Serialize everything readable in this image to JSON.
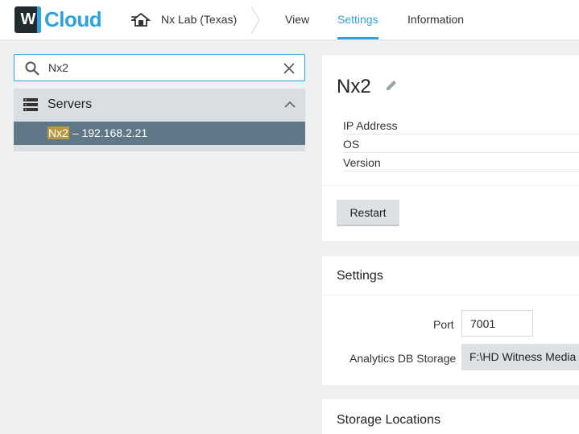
{
  "app": {
    "logo_letter": "W",
    "logo_text": "Cloud",
    "brand_color": "#2fa2db"
  },
  "header": {
    "system_name": "Nx Lab (Texas)",
    "nav": [
      {
        "label": "View"
      },
      {
        "label": "Settings",
        "active": true
      },
      {
        "label": "Information"
      }
    ]
  },
  "search": {
    "value": "Nx2",
    "placeholder": ""
  },
  "tree": {
    "group_label": "Servers",
    "selected_item": {
      "match": "Nx2",
      "rest": " – 192.168.2.21"
    }
  },
  "server": {
    "name": "Nx2",
    "info_labels": [
      "IP Address",
      "OS",
      "Version"
    ],
    "restart_label": "Restart"
  },
  "settings": {
    "title": "Settings",
    "port_label": "Port",
    "port_value": "7001",
    "storage_label": "Analytics DB Storage",
    "storage_value": "F:\\HD Witness Media"
  },
  "storage_locations": {
    "title": "Storage Locations"
  },
  "icons": {
    "search": "search-icon",
    "clear": "close-icon",
    "servers": "server-stack-icon",
    "collapse": "chevron-up-icon",
    "edit": "pencil-icon",
    "system": "house-icon"
  }
}
